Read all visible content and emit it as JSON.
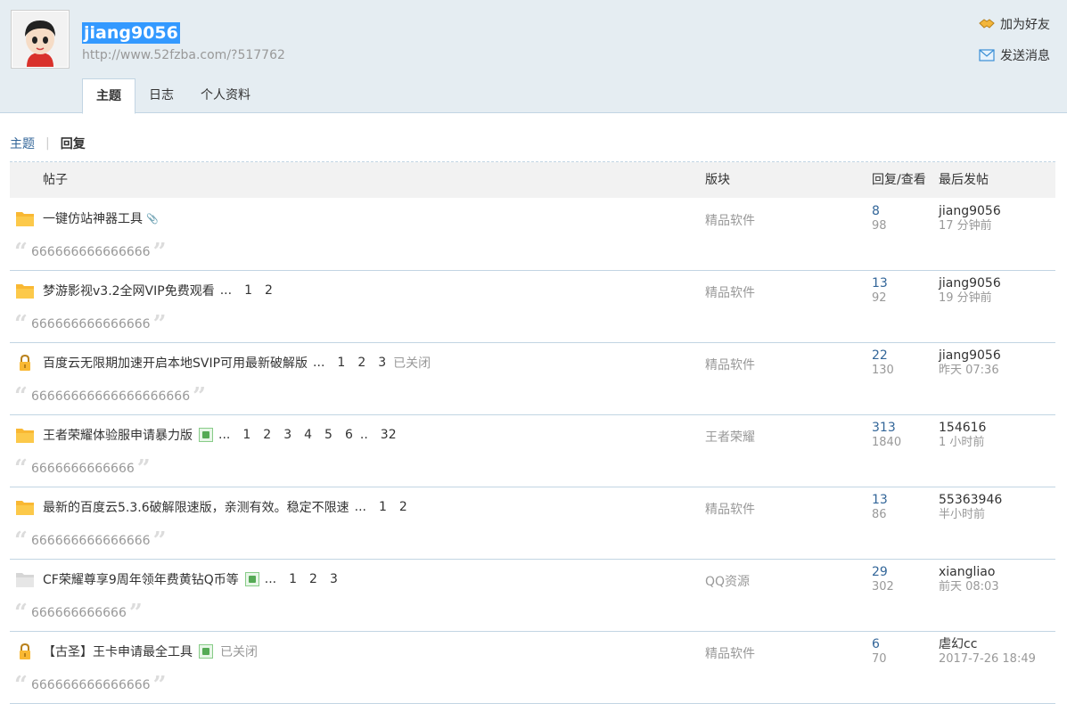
{
  "profile": {
    "username": "jiang9056",
    "url": "http://www.52fzba.com/?517762",
    "actions": {
      "add_friend": "加为好友",
      "send_message": "发送消息"
    },
    "tabs": [
      "主题",
      "日志",
      "个人资料"
    ]
  },
  "subnav": {
    "topics": "主题",
    "replies": "回复"
  },
  "table": {
    "headers": {
      "post": "帖子",
      "forum": "版块",
      "reply_view": "回复/查看",
      "last_post": "最后发帖"
    },
    "rows": [
      {
        "icon": "folder-icon",
        "title": "一键仿站神器工具",
        "attachment": true,
        "has_image": false,
        "pages": [],
        "closed": "",
        "forum": "精品软件",
        "replies": "8",
        "views": "98",
        "last_user": "jiang9056",
        "last_time": "17 分钟前",
        "quote": "666666666666666"
      },
      {
        "icon": "folder-icon",
        "title": "梦游影视v3.2全网VIP免费观看",
        "attachment": false,
        "has_image": false,
        "pages": [
          "...",
          "1",
          "2"
        ],
        "closed": "",
        "forum": "精品软件",
        "replies": "13",
        "views": "92",
        "last_user": "jiang9056",
        "last_time": "19 分钟前",
        "quote": "666666666666666"
      },
      {
        "icon": "lock-icon",
        "title": "百度云无限期加速开启本地SVIP可用最新破解版",
        "attachment": false,
        "has_image": false,
        "pages": [
          "...",
          "1",
          "2",
          "3"
        ],
        "closed": "已关闭",
        "forum": "精品软件",
        "replies": "22",
        "views": "130",
        "last_user": "jiang9056",
        "last_time": "昨天 07:36",
        "quote": "66666666666666666666"
      },
      {
        "icon": "folder-icon",
        "title": "王者荣耀体验服申请暴力版",
        "attachment": false,
        "has_image": true,
        "pages": [
          "...",
          "1",
          "2",
          "3",
          "4",
          "5",
          "6",
          "..",
          "32"
        ],
        "closed": "",
        "forum": "王者荣耀",
        "replies": "313",
        "views": "1840",
        "last_user": "154616",
        "last_time": "1 小时前",
        "quote": "6666666666666"
      },
      {
        "icon": "folder-icon",
        "title": "最新的百度云5.3.6破解限速版，亲测有效。稳定不限速",
        "attachment": false,
        "has_image": false,
        "pages": [
          "...",
          "1",
          "2"
        ],
        "closed": "",
        "forum": "精品软件",
        "replies": "13",
        "views": "86",
        "last_user": "55363946",
        "last_time": "半小时前",
        "quote": "666666666666666"
      },
      {
        "icon": "file-icon",
        "title": "CF荣耀尊享9周年领年费黄钻Q币等",
        "attachment": false,
        "has_image": true,
        "pages": [
          "...",
          "1",
          "2",
          "3"
        ],
        "closed": "",
        "forum": "QQ资源",
        "replies": "29",
        "views": "302",
        "last_user": "xiangliao",
        "last_time": "前天 08:03",
        "quote": "666666666666"
      },
      {
        "icon": "lock-icon",
        "title": "【古圣】王卡申请最全工具",
        "attachment": false,
        "has_image": true,
        "pages": [],
        "closed": "已关闭",
        "forum": "精品软件",
        "replies": "6",
        "views": "70",
        "last_user": "虐幻cc",
        "last_time": "2017-7-26 18:49",
        "quote": "666666666666666"
      }
    ]
  },
  "colors": {
    "header_bg": "#e5edf2",
    "border": "#c2d5e3",
    "link": "#336699",
    "muted": "#999999",
    "folder": "#f9b833",
    "selection": "#3399ff"
  }
}
